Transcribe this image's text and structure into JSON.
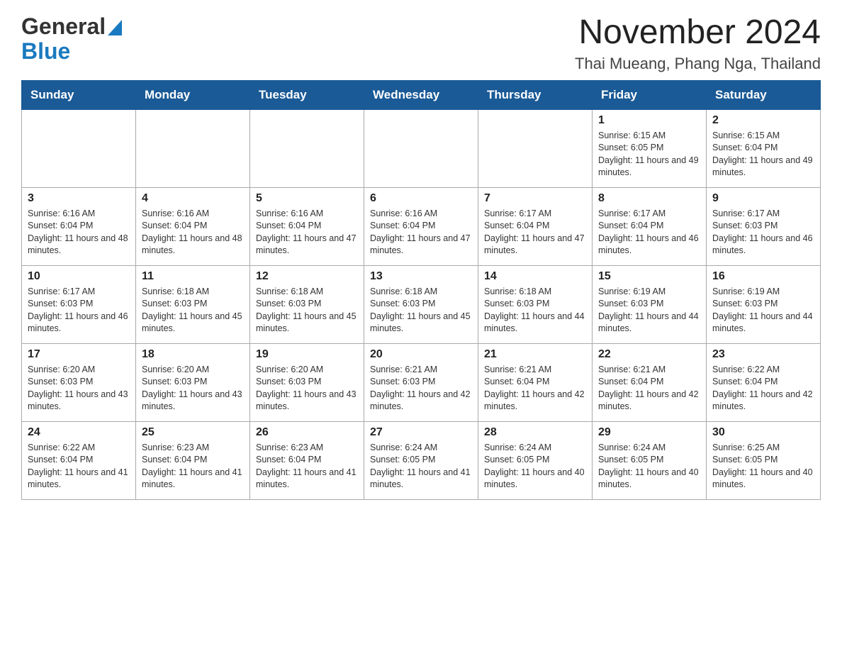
{
  "header": {
    "logo_line1": "General",
    "logo_line2": "Blue",
    "month_title": "November 2024",
    "location": "Thai Mueang, Phang Nga, Thailand"
  },
  "days_of_week": [
    "Sunday",
    "Monday",
    "Tuesday",
    "Wednesday",
    "Thursday",
    "Friday",
    "Saturday"
  ],
  "weeks": [
    [
      {
        "day": "",
        "info": ""
      },
      {
        "day": "",
        "info": ""
      },
      {
        "day": "",
        "info": ""
      },
      {
        "day": "",
        "info": ""
      },
      {
        "day": "",
        "info": ""
      },
      {
        "day": "1",
        "info": "Sunrise: 6:15 AM\nSunset: 6:05 PM\nDaylight: 11 hours and 49 minutes."
      },
      {
        "day": "2",
        "info": "Sunrise: 6:15 AM\nSunset: 6:04 PM\nDaylight: 11 hours and 49 minutes."
      }
    ],
    [
      {
        "day": "3",
        "info": "Sunrise: 6:16 AM\nSunset: 6:04 PM\nDaylight: 11 hours and 48 minutes."
      },
      {
        "day": "4",
        "info": "Sunrise: 6:16 AM\nSunset: 6:04 PM\nDaylight: 11 hours and 48 minutes."
      },
      {
        "day": "5",
        "info": "Sunrise: 6:16 AM\nSunset: 6:04 PM\nDaylight: 11 hours and 47 minutes."
      },
      {
        "day": "6",
        "info": "Sunrise: 6:16 AM\nSunset: 6:04 PM\nDaylight: 11 hours and 47 minutes."
      },
      {
        "day": "7",
        "info": "Sunrise: 6:17 AM\nSunset: 6:04 PM\nDaylight: 11 hours and 47 minutes."
      },
      {
        "day": "8",
        "info": "Sunrise: 6:17 AM\nSunset: 6:04 PM\nDaylight: 11 hours and 46 minutes."
      },
      {
        "day": "9",
        "info": "Sunrise: 6:17 AM\nSunset: 6:03 PM\nDaylight: 11 hours and 46 minutes."
      }
    ],
    [
      {
        "day": "10",
        "info": "Sunrise: 6:17 AM\nSunset: 6:03 PM\nDaylight: 11 hours and 46 minutes."
      },
      {
        "day": "11",
        "info": "Sunrise: 6:18 AM\nSunset: 6:03 PM\nDaylight: 11 hours and 45 minutes."
      },
      {
        "day": "12",
        "info": "Sunrise: 6:18 AM\nSunset: 6:03 PM\nDaylight: 11 hours and 45 minutes."
      },
      {
        "day": "13",
        "info": "Sunrise: 6:18 AM\nSunset: 6:03 PM\nDaylight: 11 hours and 45 minutes."
      },
      {
        "day": "14",
        "info": "Sunrise: 6:18 AM\nSunset: 6:03 PM\nDaylight: 11 hours and 44 minutes."
      },
      {
        "day": "15",
        "info": "Sunrise: 6:19 AM\nSunset: 6:03 PM\nDaylight: 11 hours and 44 minutes."
      },
      {
        "day": "16",
        "info": "Sunrise: 6:19 AM\nSunset: 6:03 PM\nDaylight: 11 hours and 44 minutes."
      }
    ],
    [
      {
        "day": "17",
        "info": "Sunrise: 6:20 AM\nSunset: 6:03 PM\nDaylight: 11 hours and 43 minutes."
      },
      {
        "day": "18",
        "info": "Sunrise: 6:20 AM\nSunset: 6:03 PM\nDaylight: 11 hours and 43 minutes."
      },
      {
        "day": "19",
        "info": "Sunrise: 6:20 AM\nSunset: 6:03 PM\nDaylight: 11 hours and 43 minutes."
      },
      {
        "day": "20",
        "info": "Sunrise: 6:21 AM\nSunset: 6:03 PM\nDaylight: 11 hours and 42 minutes."
      },
      {
        "day": "21",
        "info": "Sunrise: 6:21 AM\nSunset: 6:04 PM\nDaylight: 11 hours and 42 minutes."
      },
      {
        "day": "22",
        "info": "Sunrise: 6:21 AM\nSunset: 6:04 PM\nDaylight: 11 hours and 42 minutes."
      },
      {
        "day": "23",
        "info": "Sunrise: 6:22 AM\nSunset: 6:04 PM\nDaylight: 11 hours and 42 minutes."
      }
    ],
    [
      {
        "day": "24",
        "info": "Sunrise: 6:22 AM\nSunset: 6:04 PM\nDaylight: 11 hours and 41 minutes."
      },
      {
        "day": "25",
        "info": "Sunrise: 6:23 AM\nSunset: 6:04 PM\nDaylight: 11 hours and 41 minutes."
      },
      {
        "day": "26",
        "info": "Sunrise: 6:23 AM\nSunset: 6:04 PM\nDaylight: 11 hours and 41 minutes."
      },
      {
        "day": "27",
        "info": "Sunrise: 6:24 AM\nSunset: 6:05 PM\nDaylight: 11 hours and 41 minutes."
      },
      {
        "day": "28",
        "info": "Sunrise: 6:24 AM\nSunset: 6:05 PM\nDaylight: 11 hours and 40 minutes."
      },
      {
        "day": "29",
        "info": "Sunrise: 6:24 AM\nSunset: 6:05 PM\nDaylight: 11 hours and 40 minutes."
      },
      {
        "day": "30",
        "info": "Sunrise: 6:25 AM\nSunset: 6:05 PM\nDaylight: 11 hours and 40 minutes."
      }
    ]
  ]
}
